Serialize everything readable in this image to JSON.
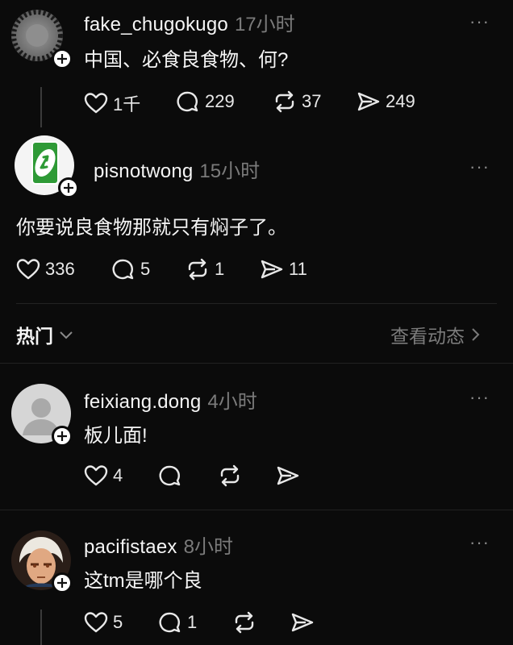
{
  "posts": [
    {
      "username": "fake_chugokugo",
      "time": "17小时",
      "text": "中国、必食良食物、何?",
      "actions": {
        "like": "1千",
        "comment": "229",
        "repost": "37",
        "share": "249"
      }
    },
    {
      "username": "pisnotwong",
      "time": "15小时",
      "text": "你要说良食物那就只有焖子了。",
      "actions": {
        "like": "336",
        "comment": "5",
        "repost": "1",
        "share": "11"
      }
    }
  ],
  "section": {
    "title": "热门",
    "link": "查看动态"
  },
  "replies": [
    {
      "username": "feixiang.dong",
      "time": "4小时",
      "text": "板儿面!",
      "actions": {
        "like": "4",
        "comment": "",
        "repost": "",
        "share": ""
      }
    },
    {
      "username": "pacifistaex",
      "time": "8小时",
      "text": "这tm是哪个良",
      "actions": {
        "like": "5",
        "comment": "1",
        "repost": "",
        "share": ""
      }
    }
  ],
  "more_label": "···",
  "colors": {
    "background": "#0b0b0b",
    "muted": "#7b7b7b",
    "uno_green": "#2e9a36"
  }
}
